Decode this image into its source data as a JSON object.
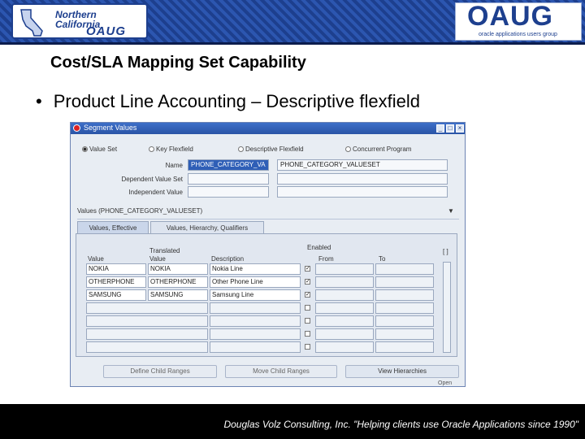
{
  "header": {
    "nc_logo_line1": "Northern",
    "nc_logo_line2": "California",
    "nc_logo_oaug": "OAUG",
    "oaug_logo_text": "OAUG",
    "oaug_tagline": "oracle applications users group"
  },
  "slide": {
    "title": "Cost/SLA Mapping Set Capability",
    "bullet_symbol": "•",
    "bullet_text": "Product Line Accounting – Descriptive flexfield"
  },
  "form": {
    "window_title": "Segment Values",
    "radios": [
      {
        "label": "Value Set",
        "selected": true
      },
      {
        "label": "Key Flexfield",
        "selected": false
      },
      {
        "label": "Descriptive Flexfield",
        "selected": false
      },
      {
        "label": "Concurrent Program",
        "selected": false
      }
    ],
    "name_label": "Name",
    "name_value": "PHONE_CATEGORY_VA",
    "name_value2": "PHONE_CATEGORY_VALUESET",
    "dependent_label": "Dependent Value Set",
    "independent_label": "Independent Value",
    "values_label": "Values (PHONE_CATEGORY_VALUESET)",
    "tabs": {
      "tab1": "Values, Effective",
      "tab2": "Values, Hierarchy, Qualifiers"
    },
    "columns": {
      "value": "Value",
      "translated_top": "Translated",
      "translated_bottom": "Value",
      "description": "Description",
      "enabled": "Enabled",
      "from": "From",
      "to": "To",
      "corner": "[ ]"
    },
    "rows": [
      {
        "value": "NOKIA",
        "translated": "NOKIA",
        "description": "Nokia Line",
        "enabled": true
      },
      {
        "value": "OTHERPHONE",
        "translated": "OTHERPHONE",
        "description": "Other Phone Line",
        "enabled": true
      },
      {
        "value": "SAMSUNG",
        "translated": "SAMSUNG",
        "description": "Samsung Line",
        "enabled": true
      },
      {
        "value": "",
        "translated": "",
        "description": "",
        "enabled": false
      },
      {
        "value": "",
        "translated": "",
        "description": "",
        "enabled": false
      },
      {
        "value": "",
        "translated": "",
        "description": "",
        "enabled": false
      },
      {
        "value": "",
        "translated": "",
        "description": "",
        "enabled": false
      }
    ],
    "buttons": {
      "b1": "Define Child Ranges",
      "b2": "Move Child Ranges",
      "b3": "View Hierarchies"
    },
    "tail_text": "Open"
  },
  "footer": {
    "text": "Douglas Volz Consulting, Inc. \"Helping clients use Oracle Applications since 1990\""
  },
  "colors": {
    "banner": "#2c56b0",
    "title_bar": "#3d6fc8",
    "highlight": "#2f5fb7"
  }
}
